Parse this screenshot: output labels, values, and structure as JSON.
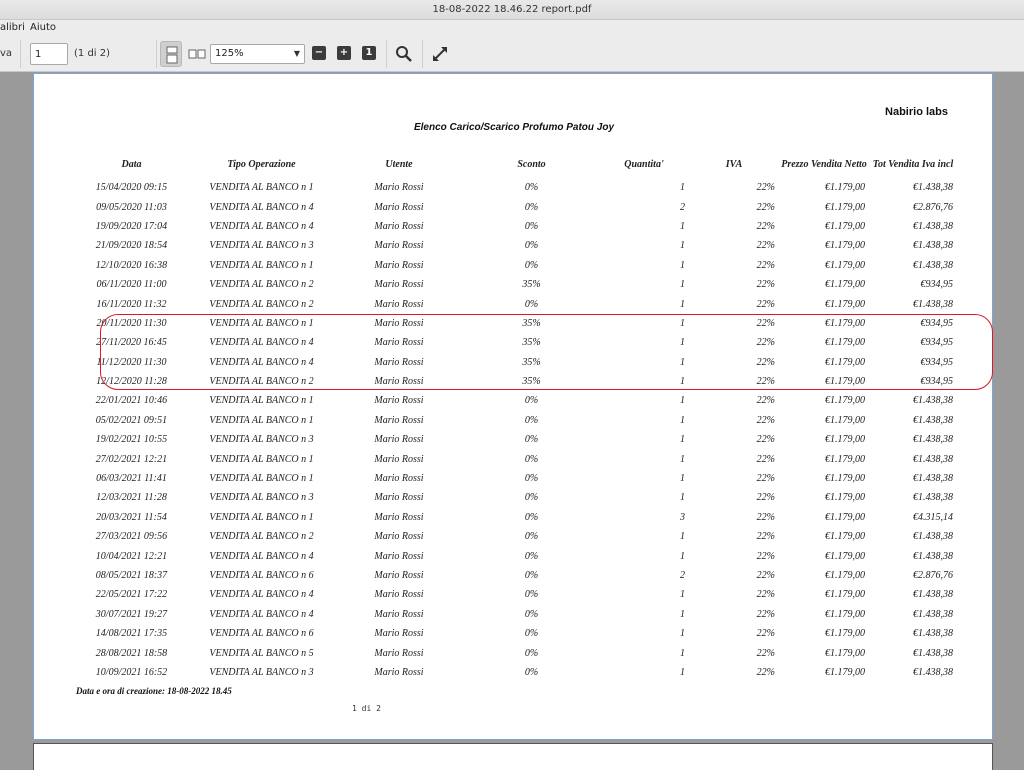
{
  "window": {
    "title": "18-08-2022 18.46.22 report.pdf"
  },
  "menu": {
    "items": [
      "alibri",
      "Aiuto"
    ]
  },
  "toolbar": {
    "left_fragment": "va",
    "page_value": "1",
    "page_count": "(1 di 2)",
    "zoom": "125%",
    "zoom_out_label": "−",
    "zoom_in_label": "+",
    "actual_size_label": "1"
  },
  "report": {
    "brand": "Nabirio labs",
    "title": "Elenco Carico/Scarico Profumo Patou Joy",
    "columns": [
      "Data",
      "Tipo Operazione",
      "Utente",
      "Sconto",
      "Quantita'",
      "IVA",
      "Prezzo Vendita Netto",
      "Tot Vendita Iva incl"
    ],
    "rows": [
      [
        "15/04/2020 09:15",
        "VENDITA AL BANCO n 1",
        "Mario Rossi",
        "0%",
        "1",
        "22%",
        "€1.179,00",
        "€1.438,38"
      ],
      [
        "09/05/2020 11:03",
        "VENDITA AL BANCO n 4",
        "Mario Rossi",
        "0%",
        "2",
        "22%",
        "€1.179,00",
        "€2.876,76"
      ],
      [
        "19/09/2020 17:04",
        "VENDITA AL BANCO n 4",
        "Mario Rossi",
        "0%",
        "1",
        "22%",
        "€1.179,00",
        "€1.438,38"
      ],
      [
        "21/09/2020 18:54",
        "VENDITA AL BANCO n 3",
        "Mario Rossi",
        "0%",
        "1",
        "22%",
        "€1.179,00",
        "€1.438,38"
      ],
      [
        "12/10/2020 16:38",
        "VENDITA AL BANCO n 1",
        "Mario Rossi",
        "0%",
        "1",
        "22%",
        "€1.179,00",
        "€1.438,38"
      ],
      [
        "06/11/2020 11:00",
        "VENDITA AL BANCO n 2",
        "Mario Rossi",
        "35%",
        "1",
        "22%",
        "€1.179,00",
        "€934,95"
      ],
      [
        "16/11/2020 11:32",
        "VENDITA AL BANCO n 2",
        "Mario Rossi",
        "0%",
        "1",
        "22%",
        "€1.179,00",
        "€1.438,38"
      ],
      [
        "20/11/2020 11:30",
        "VENDITA AL BANCO n 1",
        "Mario Rossi",
        "35%",
        "1",
        "22%",
        "€1.179,00",
        "€934,95"
      ],
      [
        "27/11/2020 16:45",
        "VENDITA AL BANCO n 4",
        "Mario Rossi",
        "35%",
        "1",
        "22%",
        "€1.179,00",
        "€934,95"
      ],
      [
        "11/12/2020 11:30",
        "VENDITA AL BANCO n 4",
        "Mario Rossi",
        "35%",
        "1",
        "22%",
        "€1.179,00",
        "€934,95"
      ],
      [
        "12/12/2020 11:28",
        "VENDITA AL BANCO n 2",
        "Mario Rossi",
        "35%",
        "1",
        "22%",
        "€1.179,00",
        "€934,95"
      ],
      [
        "22/01/2021 10:46",
        "VENDITA AL BANCO n 1",
        "Mario Rossi",
        "0%",
        "1",
        "22%",
        "€1.179,00",
        "€1.438,38"
      ],
      [
        "05/02/2021 09:51",
        "VENDITA AL BANCO n 1",
        "Mario Rossi",
        "0%",
        "1",
        "22%",
        "€1.179,00",
        "€1.438,38"
      ],
      [
        "19/02/2021 10:55",
        "VENDITA AL BANCO n 3",
        "Mario Rossi",
        "0%",
        "1",
        "22%",
        "€1.179,00",
        "€1.438,38"
      ],
      [
        "27/02/2021 12:21",
        "VENDITA AL BANCO n 1",
        "Mario Rossi",
        "0%",
        "1",
        "22%",
        "€1.179,00",
        "€1.438,38"
      ],
      [
        "06/03/2021 11:41",
        "VENDITA AL BANCO n 1",
        "Mario Rossi",
        "0%",
        "1",
        "22%",
        "€1.179,00",
        "€1.438,38"
      ],
      [
        "12/03/2021 11:28",
        "VENDITA AL BANCO n 3",
        "Mario Rossi",
        "0%",
        "1",
        "22%",
        "€1.179,00",
        "€1.438,38"
      ],
      [
        "20/03/2021 11:54",
        "VENDITA AL BANCO n 1",
        "Mario Rossi",
        "0%",
        "3",
        "22%",
        "€1.179,00",
        "€4.315,14"
      ],
      [
        "27/03/2021 09:56",
        "VENDITA AL BANCO n 2",
        "Mario Rossi",
        "0%",
        "1",
        "22%",
        "€1.179,00",
        "€1.438,38"
      ],
      [
        "10/04/2021 12:21",
        "VENDITA AL BANCO n 4",
        "Mario Rossi",
        "0%",
        "1",
        "22%",
        "€1.179,00",
        "€1.438,38"
      ],
      [
        "08/05/2021 18:37",
        "VENDITA AL BANCO n 6",
        "Mario Rossi",
        "0%",
        "2",
        "22%",
        "€1.179,00",
        "€2.876,76"
      ],
      [
        "22/05/2021 17:22",
        "VENDITA AL BANCO n 4",
        "Mario Rossi",
        "0%",
        "1",
        "22%",
        "€1.179,00",
        "€1.438,38"
      ],
      [
        "30/07/2021 19:27",
        "VENDITA AL BANCO n 4",
        "Mario Rossi",
        "0%",
        "1",
        "22%",
        "€1.179,00",
        "€1.438,38"
      ],
      [
        "14/08/2021 17:35",
        "VENDITA AL BANCO n 6",
        "Mario Rossi",
        "0%",
        "1",
        "22%",
        "€1.179,00",
        "€1.438,38"
      ],
      [
        "28/08/2021 18:58",
        "VENDITA AL BANCO n 5",
        "Mario Rossi",
        "0%",
        "1",
        "22%",
        "€1.179,00",
        "€1.438,38"
      ],
      [
        "10/09/2021 16:52",
        "VENDITA AL BANCO n 3",
        "Mario Rossi",
        "0%",
        "1",
        "22%",
        "€1.179,00",
        "€1.438,38"
      ]
    ],
    "footer_note": "Data e ora di creazione: 18-08-2022 18.45",
    "page_number": "1 di 2"
  },
  "colors": {
    "highlight": "#d8182f",
    "page_border": "#7aa6d6"
  }
}
